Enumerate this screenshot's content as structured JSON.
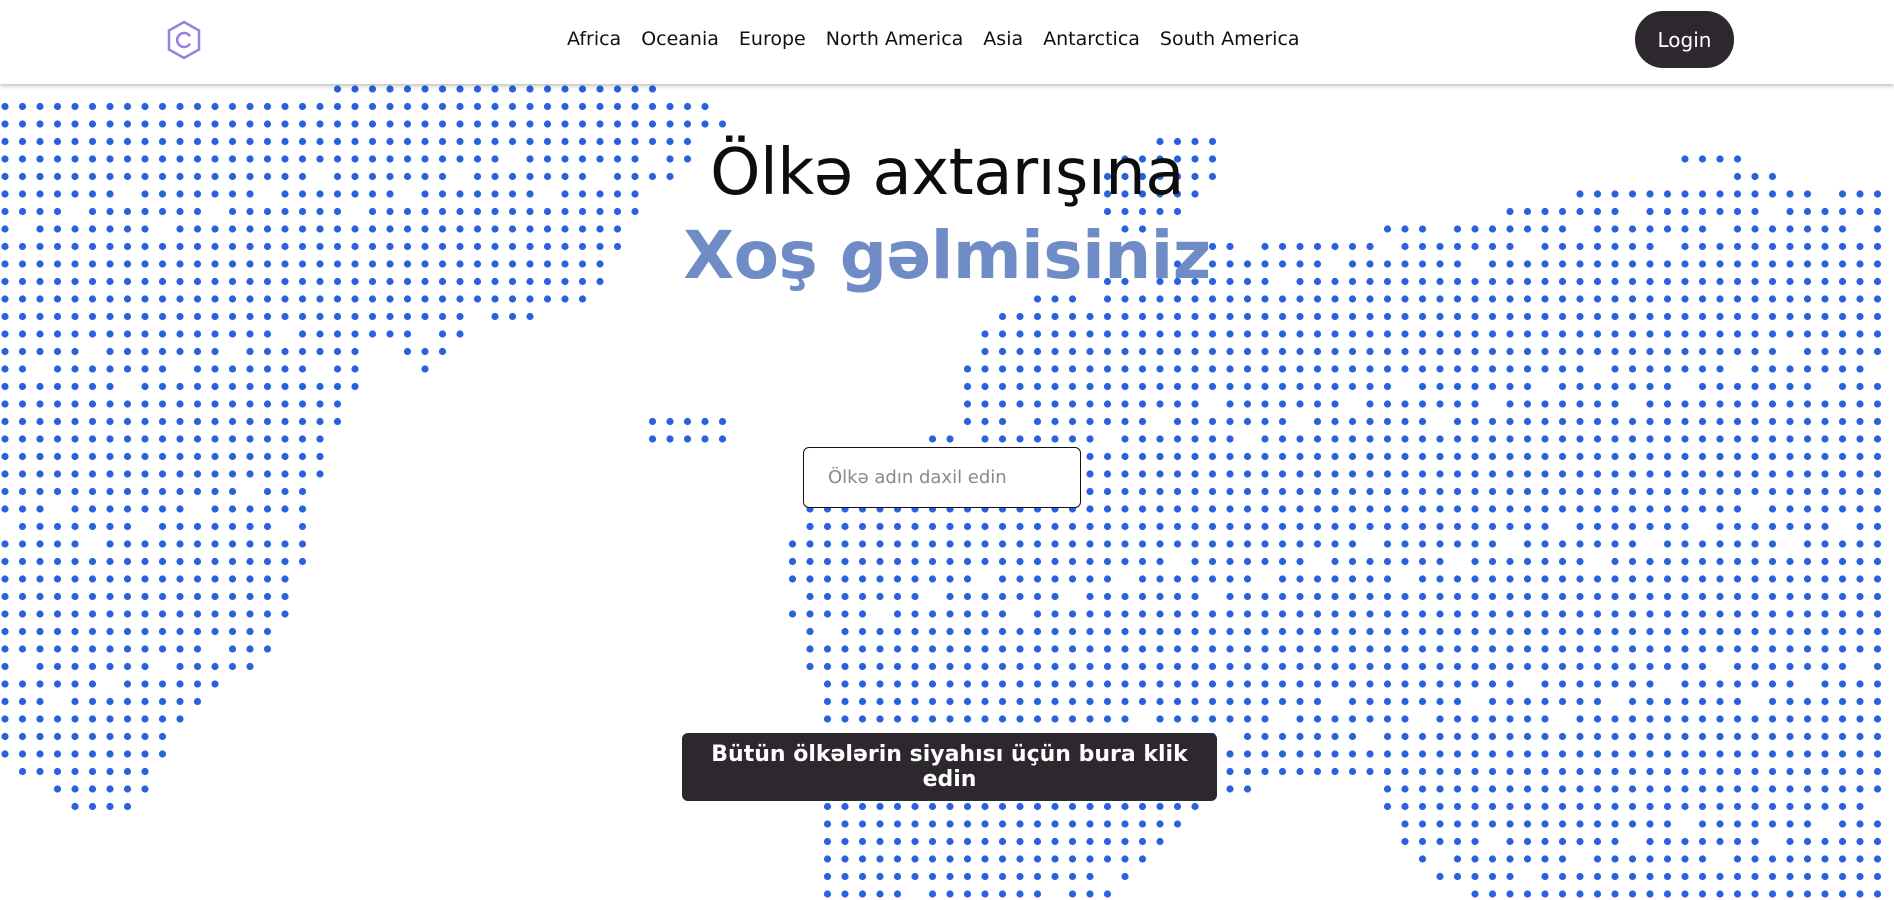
{
  "navbar": {
    "logo_icon": "hexagon-c-logo-icon",
    "links": [
      {
        "label": "Africa"
      },
      {
        "label": "Oceania"
      },
      {
        "label": "Europe"
      },
      {
        "label": "North America"
      },
      {
        "label": "Asia"
      },
      {
        "label": "Antarctica"
      },
      {
        "label": "South America"
      }
    ],
    "login_label": "Login"
  },
  "hero": {
    "title": "Ölkə axtarışına",
    "subtitle": "Xoş gəlmisiniz",
    "search_placeholder": "Ölkə adın daxil edin",
    "all_countries_label": "Bütün ölkələrin siyahısı üçün bura klik edin"
  },
  "colors": {
    "dots": "#2a62de",
    "subtitle": "#6f8cc7",
    "dark_button": "#2d282e",
    "logo": "#9b7fe0"
  }
}
